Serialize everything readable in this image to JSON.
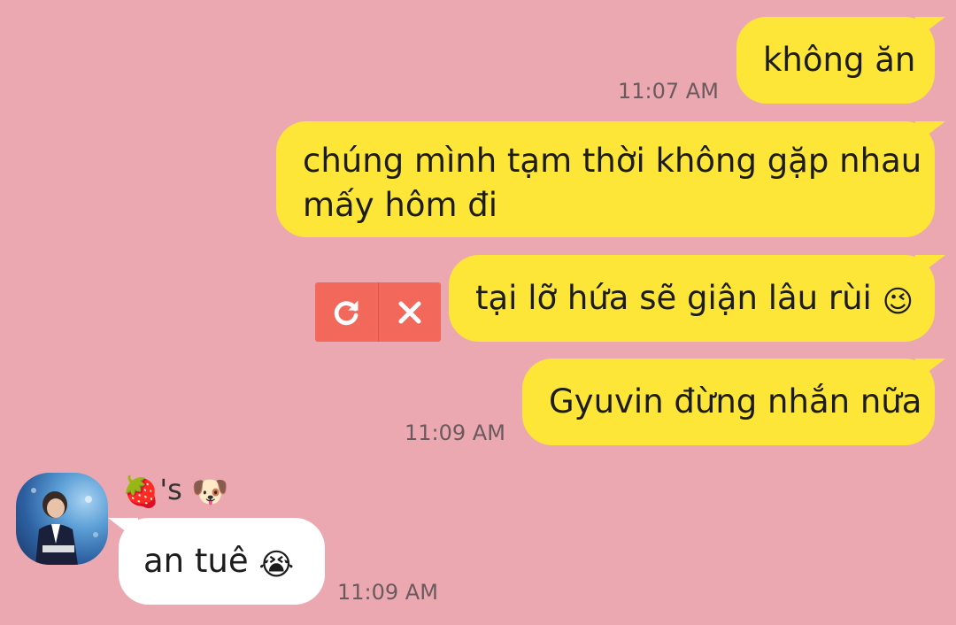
{
  "messages": [
    {
      "text": "không ăn",
      "time": "11:07 AM"
    },
    {
      "line1": "chúng mình tạm thời không gặp nhau",
      "line2": "mấy hôm đi"
    },
    {
      "text": "tại lỡ hứa sẽ giận lâu rùi",
      "emoji": "😉"
    },
    {
      "text": "Gyuvin đừng nhắn nữa",
      "time": "11:09 AM"
    }
  ],
  "incoming": {
    "sender_emoji_1": "🍓",
    "sender_suffix": "'s",
    "sender_emoji_2": "🐶",
    "text": "an tuê",
    "emoji": "😭",
    "time": "11:09 AM"
  },
  "failed_controls": {
    "retry_icon": "refresh-icon",
    "delete_icon": "close-icon"
  },
  "colors": {
    "background": "#EBA8B1",
    "outgoing_bubble": "#FDE637",
    "incoming_bubble": "#FFFFFF",
    "error_accent": "#F2695C"
  }
}
